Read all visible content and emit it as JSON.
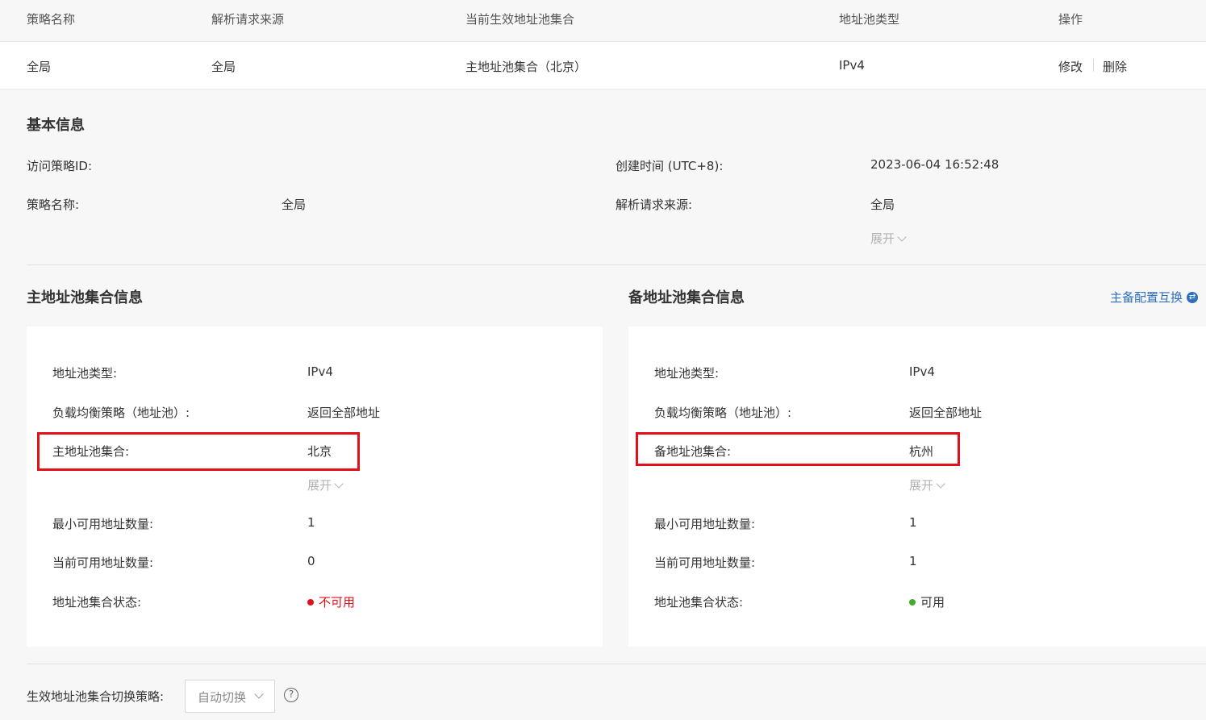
{
  "table": {
    "headers": [
      "策略名称",
      "解析请求来源",
      "当前生效地址池集合",
      "地址池类型",
      "操作"
    ],
    "row": {
      "name": "全局",
      "source": "全局",
      "active_pool": "主地址池集合（北京）",
      "pool_type": "IPv4",
      "edit": "修改",
      "delete": "删除"
    }
  },
  "basic": {
    "title": "基本信息",
    "policy_id_label": "访问策略ID:",
    "policy_id_value": "",
    "created_label": "创建时间 (UTC+8):",
    "created_value": "2023-06-04 16:52:48",
    "name_label": "策略名称:",
    "name_value": "全局",
    "source_label": "解析请求来源:",
    "source_value": "全局",
    "expand": "展开"
  },
  "primary": {
    "title": "主地址池集合信息",
    "type_label": "地址池类型:",
    "type_value": "IPv4",
    "lb_label": "负载均衡策略（地址池）:",
    "lb_value": "返回全部地址",
    "set_label": "主地址池集合:",
    "set_value": "北京",
    "expand": "展开",
    "min_label": "最小可用地址数量:",
    "min_value": "1",
    "cur_label": "当前可用地址数量:",
    "cur_value": "0",
    "status_label": "地址池集合状态:",
    "status_value": "不可用",
    "status_color": "#e3101a"
  },
  "backup": {
    "title": "备地址池集合信息",
    "swap_label": "主备配置互换",
    "type_label": "地址池类型:",
    "type_value": "IPv4",
    "lb_label": "负载均衡策略（地址池）:",
    "lb_value": "返回全部地址",
    "set_label": "备地址池集合:",
    "set_value": "杭州",
    "expand": "展开",
    "min_label": "最小可用地址数量:",
    "min_value": "1",
    "cur_label": "当前可用地址数量:",
    "cur_value": "1",
    "status_label": "地址池集合状态:",
    "status_value": "可用",
    "status_color": "#3fae2a"
  },
  "switch": {
    "label": "生效地址池集合切换策略:",
    "value": "自动切换",
    "help_icon": "question-circle-icon"
  },
  "colors": {
    "link": "#2f6fbf",
    "highlight": "#e3101a"
  }
}
